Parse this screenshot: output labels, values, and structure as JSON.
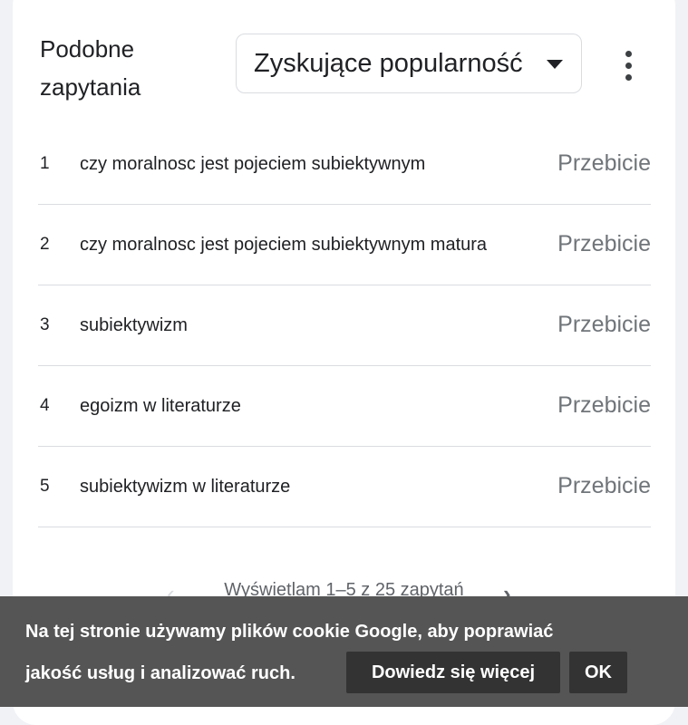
{
  "header": {
    "title_line1": "Podobne",
    "title_line2": "zapytania"
  },
  "dropdown": {
    "selected": "Zyskujące popularność",
    "arrow_icon": "triangle-down-icon"
  },
  "more_menu": {
    "icon": "more-vert-icon"
  },
  "queries": [
    {
      "rank": "1",
      "query": "czy moralnosc jest pojeciem subiektywnym",
      "value": "Przebicie"
    },
    {
      "rank": "2",
      "query": "czy moralnosc jest pojeciem subiektywnym matura",
      "value": "Przebicie"
    },
    {
      "rank": "3",
      "query": "subiektywizm",
      "value": "Przebicie"
    },
    {
      "rank": "4",
      "query": "egoizm w literaturze",
      "value": "Przebicie"
    },
    {
      "rank": "5",
      "query": "subiektywizm w literaturze",
      "value": "Przebicie"
    }
  ],
  "pagination": {
    "text": "Wyświetlam 1–5 z 25 zapytań",
    "prev_icon": "chevron-left-icon",
    "next_icon": "chevron-right-icon"
  },
  "cookie_banner": {
    "line1": "Na tej stronie używamy plików cookie Google, aby poprawiać",
    "line2": "jakość usług i analizować ruch.",
    "learn_more_label": "Dowiedz się więcej",
    "ok_label": "OK"
  },
  "colors": {
    "text_primary": "#202124",
    "text_secondary": "#70757a",
    "divider": "#dadce0",
    "cookie_bg": "#555555",
    "cookie_button_bg": "#333333"
  }
}
